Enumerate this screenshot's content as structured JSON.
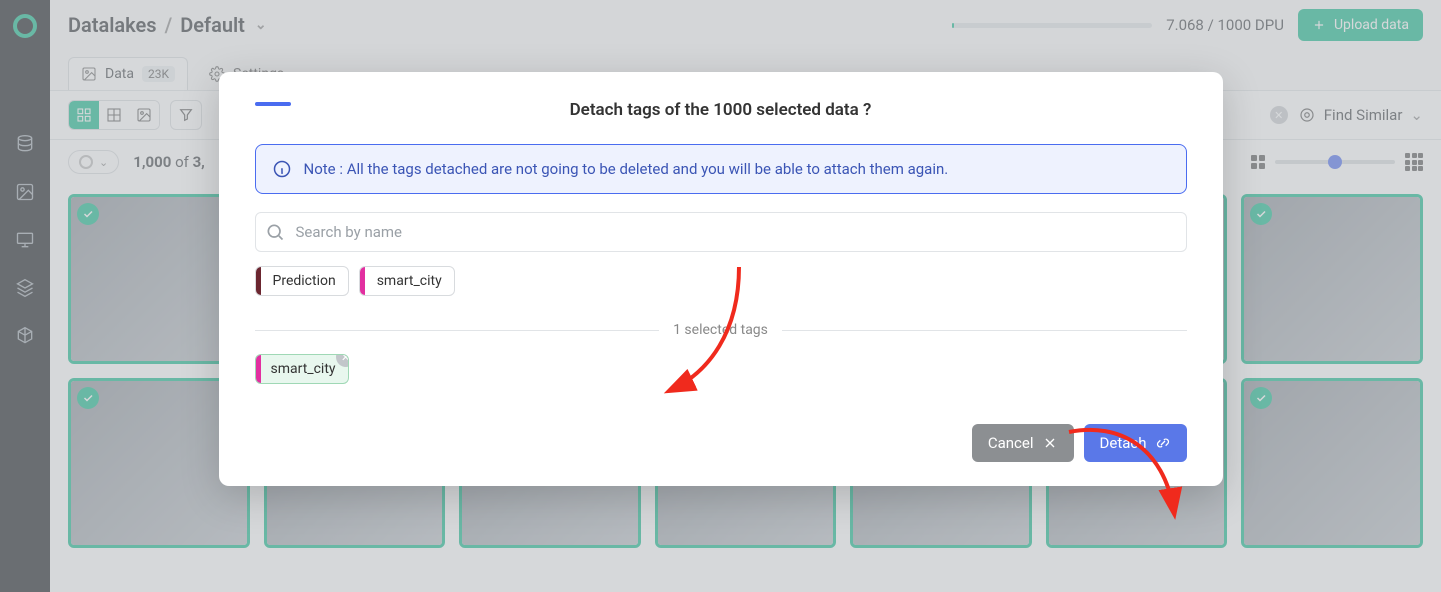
{
  "breadcrumb": {
    "root": "Datalakes",
    "current": "Default"
  },
  "dpu": {
    "text": "7.068 / 1000 DPU"
  },
  "header": {
    "upload_label": "Upload data"
  },
  "tabs": {
    "data": {
      "label": "Data",
      "badge": "23K"
    },
    "settings": {
      "label": "Settings"
    }
  },
  "toolbar": {
    "find_similar": "Find Similar"
  },
  "selection": {
    "count_html_prefix": "1,000",
    "count_mid": " of ",
    "count_suffix": "3,"
  },
  "modal": {
    "title": "Detach tags of the 1000 selected data ?",
    "note": "Note : All the tags detached are not going to be deleted and you will be able to attach them again.",
    "search_placeholder": "Search by name",
    "available_tags": [
      {
        "label": "Prediction",
        "color": "#6b2630"
      },
      {
        "label": "smart_city",
        "color": "#e22fa0"
      }
    ],
    "selected_divider": "1 selected tags",
    "selected_tags": [
      {
        "label": "smart_city",
        "color": "#e22fa0"
      }
    ],
    "cancel_label": "Cancel",
    "detach_label": "Detach"
  }
}
